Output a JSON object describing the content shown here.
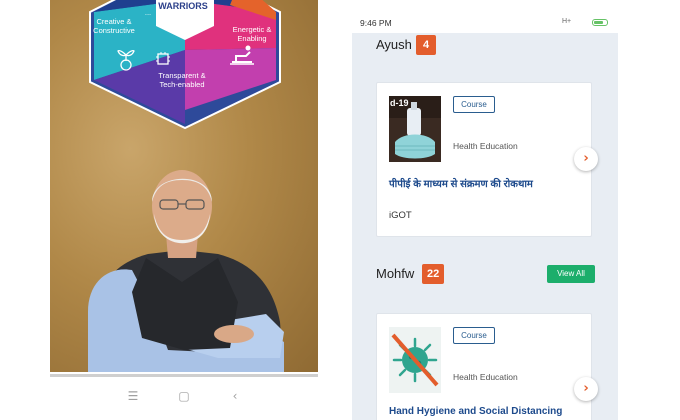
{
  "left_phone": {
    "badge": {
      "title": "WARRIORS",
      "top_right": "...",
      "segments": [
        {
          "text": "Creative &\nConstructive"
        },
        {
          "text": "Energetic &\nEnabling"
        },
        {
          "text": "Transparent &\nTech-enabled"
        }
      ]
    },
    "nav": {
      "menu_icon": "☰",
      "home_icon": "▢",
      "back_icon": "‹"
    }
  },
  "right_phone": {
    "status_bar": {
      "time": "9:46 PM",
      "network": "H+"
    },
    "sections": [
      {
        "title": "Ayush",
        "count": "4",
        "cards": [
          {
            "thumb_text": "d-19",
            "tag": "Course",
            "category": "Health Education",
            "title": "पीपीई के माध्यम से संक्रमण की रोकथाम",
            "source": "iGOT"
          }
        ]
      },
      {
        "title": "Mohfw",
        "count": "22",
        "view_all": "View All",
        "cards": [
          {
            "tag": "Course",
            "category": "Health Education",
            "title": "Hand Hygiene and Social Distancing"
          }
        ]
      }
    ],
    "arrow_glyph": "›",
    "colors": {
      "accent_orange": "#e35d2c",
      "view_all_green": "#1cae6b",
      "link_blue": "#1d4a8c",
      "background": "#e8edf3"
    }
  }
}
